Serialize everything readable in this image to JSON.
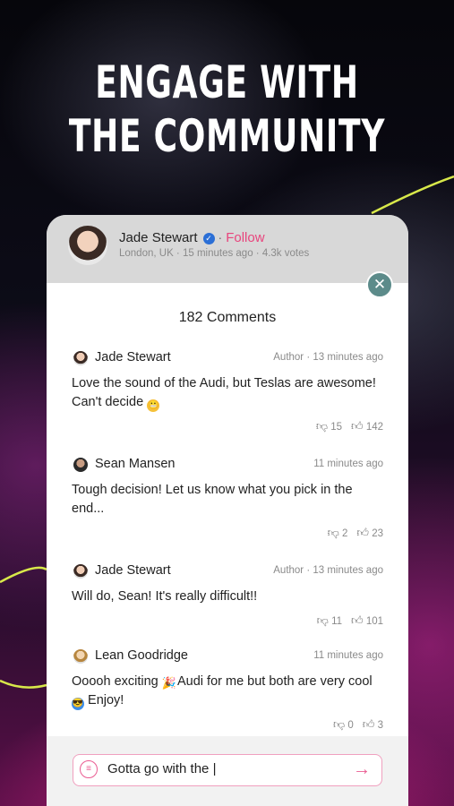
{
  "headline": {
    "line1": "ENGAGE WITH",
    "line2": "THE COMMUNITY"
  },
  "post_header": {
    "name": "Jade Stewart",
    "follow_label": "Follow",
    "meta": "London, UK · 15 minutes ago · 4.3k votes"
  },
  "comments_title": "182 Comments",
  "comments": [
    {
      "name": "Jade Stewart",
      "time": "Author · 13 minutes ago",
      "text": "Love the sound of the Audi, but Teslas are awesome! Can't decide",
      "emoji": "grimacing-emoji",
      "dislikes": "15",
      "likes": "142"
    },
    {
      "name": "Sean Mansen",
      "time": "11 minutes ago",
      "text": "Tough decision! Let us know what you pick in the end...",
      "dislikes": "2",
      "likes": "23"
    },
    {
      "name": "Jade Stewart",
      "time": "Author · 13 minutes ago",
      "text": "Will do, Sean! It's really difficult!!",
      "dislikes": "11",
      "likes": "101"
    },
    {
      "name": "Lean Goodridge",
      "time": "11 minutes ago",
      "text_part1": "Ooooh exciting",
      "text_part2": "Audi for me but both are very cool",
      "text_part3": "Enjoy!",
      "dislikes": "0",
      "likes": "3"
    }
  ],
  "input": {
    "value": "Gotta go with the |"
  },
  "icons": {
    "verified": "verified-badge-icon",
    "close": "close-icon",
    "dislike": "thumbs-down-icon",
    "like": "thumbs-up-icon",
    "chat": "chat-bubble-icon",
    "send": "arrow-right-icon"
  },
  "colors": {
    "accent_pink": "#e8457d",
    "verified_blue": "#2b6fd6",
    "close_teal": "#5c8b8a",
    "deco_lines": "#d8e84a"
  }
}
